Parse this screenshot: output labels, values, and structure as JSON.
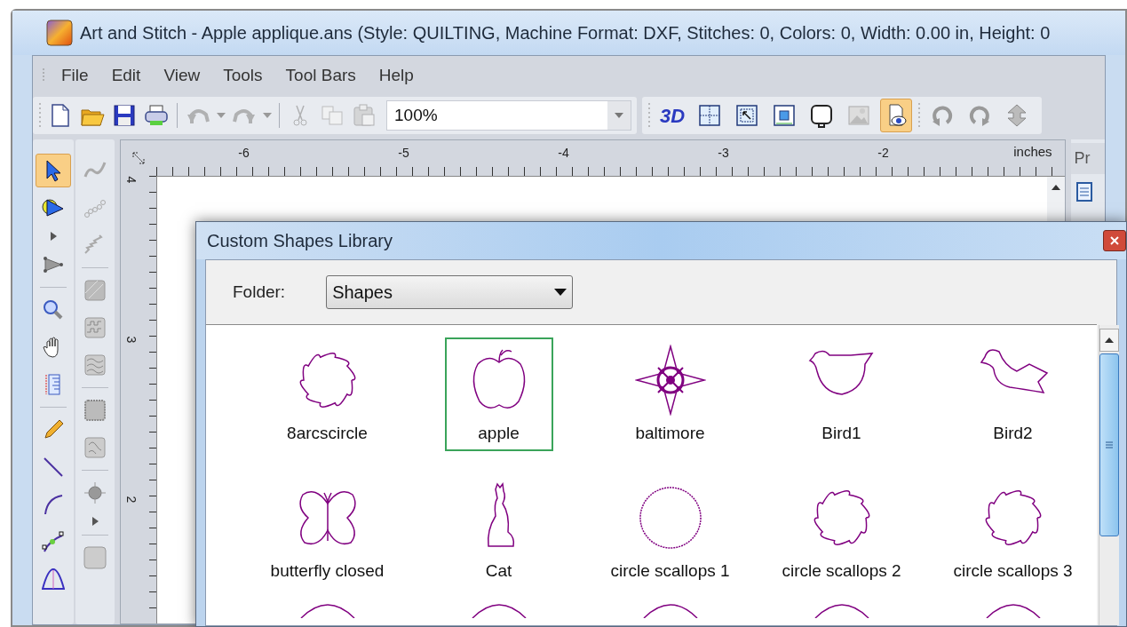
{
  "window": {
    "title": "Art and Stitch - Apple applique.ans (Style: QUILTING, Machine Format: DXF, Stitches: 0, Colors: 0, Width: 0.00 in, Height: 0"
  },
  "menu": [
    "File",
    "Edit",
    "View",
    "Tools",
    "Tool Bars",
    "Help"
  ],
  "toolbar": {
    "left": [
      [
        {
          "kind": "new",
          "disabled": false
        },
        {
          "kind": "open",
          "disabled": false
        },
        {
          "kind": "save",
          "disabled": false
        },
        {
          "kind": "print",
          "disabled": false
        }
      ],
      [
        {
          "kind": "undo",
          "disabled": true
        },
        {
          "kind": "drop",
          "disabled": true
        },
        {
          "kind": "redo",
          "disabled": true
        },
        {
          "kind": "drop",
          "disabled": true
        }
      ],
      [
        {
          "kind": "cut",
          "disabled": true
        },
        {
          "kind": "copy",
          "disabled": true
        },
        {
          "kind": "paste",
          "disabled": true
        }
      ]
    ],
    "zoom": {
      "value": "100%"
    },
    "right": [
      [
        {
          "kind": "threed",
          "label": "3D",
          "selected": false
        },
        {
          "kind": "grid",
          "selected": false
        },
        {
          "kind": "selbox",
          "selected": false
        },
        {
          "kind": "frame",
          "selected": false
        },
        {
          "kind": "hoop",
          "selected": false
        },
        {
          "kind": "picture",
          "selected": false
        },
        {
          "kind": "preview",
          "selected": true
        }
      ],
      [
        {
          "kind": "rotl",
          "selected": false
        },
        {
          "kind": "rotr",
          "selected": false
        },
        {
          "kind": "flip",
          "selected": false
        }
      ]
    ]
  },
  "tools_1": [
    [
      {
        "kind": "arrow",
        "selected": true
      },
      {
        "kind": "brush",
        "selected": false
      },
      {
        "kind": "caret",
        "selected": false
      },
      {
        "kind": "digitize",
        "selected": false
      }
    ],
    [
      {
        "kind": "zoom",
        "selected": false
      },
      {
        "kind": "hand",
        "selected": false
      },
      {
        "kind": "ruler",
        "selected": false
      }
    ],
    [
      {
        "kind": "pencil",
        "selected": false
      },
      {
        "kind": "line",
        "selected": false
      },
      {
        "kind": "arc",
        "selected": false
      },
      {
        "kind": "nodes",
        "selected": false
      },
      {
        "kind": "arch",
        "selected": false
      }
    ]
  ],
  "tools_2": [
    [
      {
        "kind": "wave",
        "selected": false
      },
      {
        "kind": "chain",
        "selected": false
      },
      {
        "kind": "zigzag",
        "selected": false
      }
    ],
    [
      {
        "kind": "fill1",
        "selected": false
      },
      {
        "kind": "fill2",
        "selected": false
      },
      {
        "kind": "fill3",
        "selected": false
      }
    ],
    [
      {
        "kind": "fill4",
        "selected": false
      },
      {
        "kind": "fill5",
        "selected": false
      }
    ],
    [
      {
        "kind": "target",
        "selected": false
      },
      {
        "kind": "caret",
        "selected": false
      }
    ],
    [
      {
        "kind": "square",
        "selected": false
      }
    ]
  ],
  "ruler": {
    "h_labels": [
      "-6",
      "-5",
      "-4",
      "-3",
      "-2"
    ],
    "units": "inches",
    "v_labels": [
      "4",
      "3",
      "2"
    ]
  },
  "side_panel": {
    "tab": "Pr"
  },
  "dialog": {
    "title": "Custom Shapes Library",
    "folder_label": "Folder:",
    "folder": "Shapes",
    "shapes": [
      {
        "label": "8arcscircle",
        "kind": "flower",
        "selected": false
      },
      {
        "label": "apple",
        "kind": "apple",
        "selected": true
      },
      {
        "label": "baltimore",
        "kind": "medallion",
        "selected": false
      },
      {
        "label": "Bird1",
        "kind": "bird",
        "selected": false
      },
      {
        "label": "Bird2",
        "kind": "bird2",
        "selected": false
      },
      {
        "label": "butterfly closed",
        "kind": "butterfly",
        "selected": false
      },
      {
        "label": "Cat",
        "kind": "cat",
        "selected": false
      },
      {
        "label": "circle scallops 1",
        "kind": "circle",
        "selected": false
      },
      {
        "label": "circle scallops 2",
        "kind": "flower",
        "selected": false
      },
      {
        "label": "circle scallops 3",
        "kind": "flower",
        "selected": false
      }
    ]
  }
}
